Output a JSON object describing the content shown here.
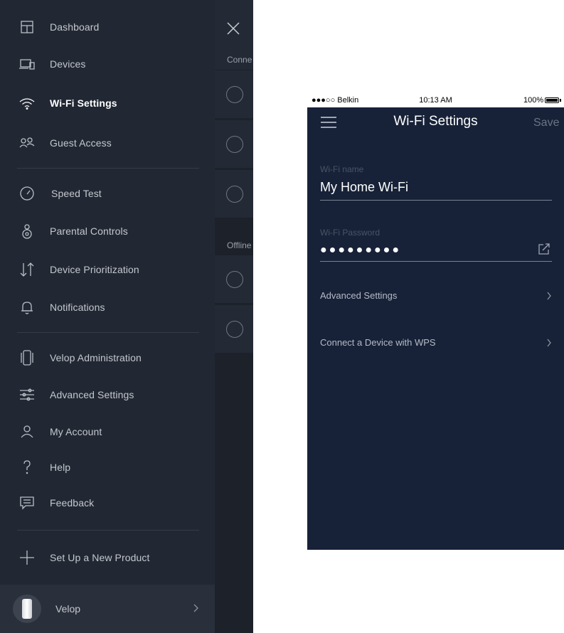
{
  "drawer": {
    "items": [
      {
        "label": "Dashboard",
        "icon": "dashboard-icon"
      },
      {
        "label": "Devices",
        "icon": "devices-icon"
      },
      {
        "label": "Wi-Fi Settings",
        "icon": "wifi-icon",
        "active": true
      },
      {
        "label": "Guest Access",
        "icon": "guest-access-icon"
      },
      {
        "label": "Speed Test",
        "icon": "speedometer-icon"
      },
      {
        "label": "Parental Controls",
        "icon": "parental-controls-icon"
      },
      {
        "label": "Device Prioritization",
        "icon": "prioritization-arrows-icon"
      },
      {
        "label": "Notifications",
        "icon": "bell-icon"
      },
      {
        "label": "Velop Administration",
        "icon": "velop-node-icon"
      },
      {
        "label": "Advanced Settings",
        "icon": "sliders-icon"
      },
      {
        "label": "My Account",
        "icon": "person-icon"
      },
      {
        "label": "Help",
        "icon": "question-mark-icon"
      },
      {
        "label": "Feedback",
        "icon": "chat-bubble-icon"
      },
      {
        "label": "Set Up a New Product",
        "icon": "plus-icon"
      }
    ],
    "footer": {
      "label": "Velop",
      "icon": "velop-node-avatar"
    }
  },
  "behind_panel": {
    "section_connected": "Conne",
    "section_offline": "Offline"
  },
  "phone": {
    "status_bar": {
      "carrier": "●●●○○ Belkin",
      "time": "10:13 AM",
      "battery": "100%"
    },
    "title": "Wi-Fi Settings",
    "save_label": "Save",
    "wifi_name_label": "Wi-Fi name",
    "wifi_name_value": "My Home Wi-Fi",
    "wifi_password_label": "Wi-Fi Password",
    "wifi_password_value": "●●●●●●●●●",
    "rows": [
      {
        "label": "Advanced Settings"
      },
      {
        "label": "Connect a Device with WPS"
      }
    ]
  },
  "colors": {
    "drawer_bg": "#222833",
    "phone_bg": "#172238",
    "text_light": "#c3c7ce"
  }
}
